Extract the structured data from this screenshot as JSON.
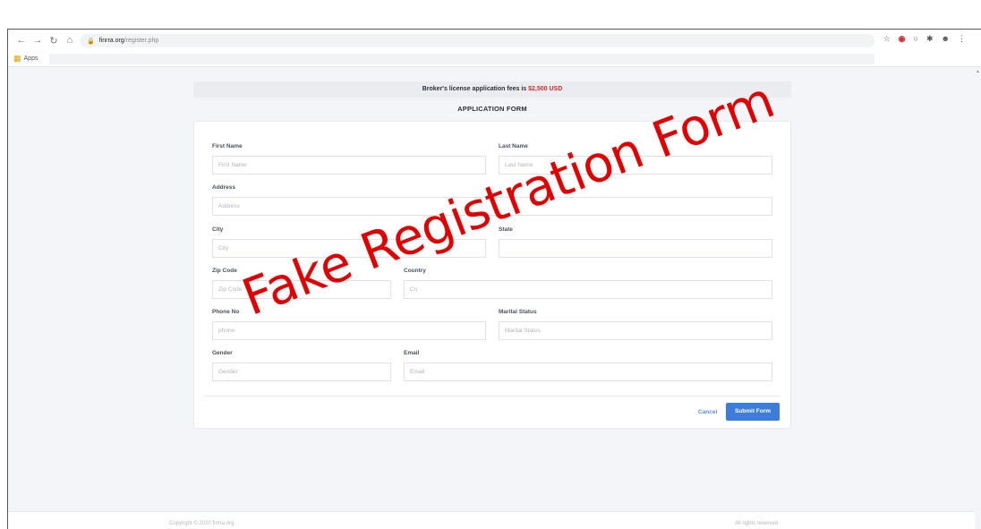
{
  "browser": {
    "url_host": "finrra.org",
    "url_path": "/register.php",
    "bookmarks_apps": "Apps"
  },
  "notice": {
    "prefix": "Broker's license application fees is ",
    "fee": "$2,500 USD"
  },
  "form": {
    "title": "APPLICATION FORM",
    "fields": {
      "first_name": {
        "label": "First Name",
        "placeholder": "First Name"
      },
      "last_name": {
        "label": "Last Name",
        "placeholder": "Last Name"
      },
      "address": {
        "label": "Address",
        "placeholder": "Address"
      },
      "city": {
        "label": "City",
        "placeholder": "City"
      },
      "state": {
        "label": "State",
        "placeholder": ""
      },
      "zip": {
        "label": "Zip Code",
        "placeholder": "Zip Code"
      },
      "country": {
        "label": "Country",
        "placeholder": "Co"
      },
      "phone": {
        "label": "Phone No",
        "placeholder": "phone"
      },
      "marital": {
        "label": "Marital Status",
        "placeholder": "Marital Status"
      },
      "gender": {
        "label": "Gender",
        "placeholder": "Gender"
      },
      "email": {
        "label": "Email",
        "placeholder": "Email"
      }
    },
    "cancel_label": "Cancel",
    "submit_label": "Submit Form"
  },
  "watermark": "Fake Registration Form",
  "footer": {
    "copyright": "Copyright © 2020 finrra.org",
    "rights": "All rights reserved"
  },
  "colors": {
    "fee": "#e0252b",
    "submit": "#3b7dd8",
    "watermark": "#e10000"
  }
}
